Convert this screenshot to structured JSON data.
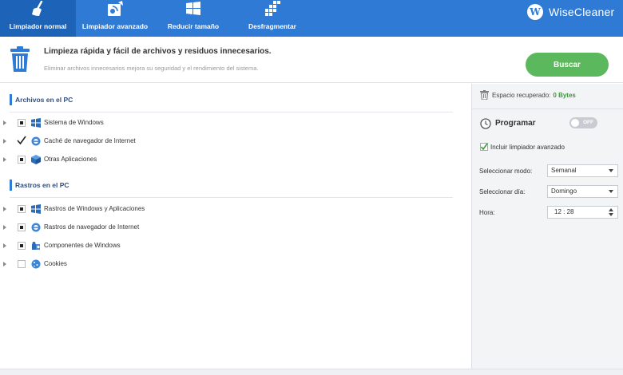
{
  "toolbar": {
    "tabs": [
      {
        "label": "Limpiador normal",
        "icon": "broom-icon",
        "active": true
      },
      {
        "label": "Limpiador avanzado",
        "icon": "advanced-clean-icon",
        "active": false
      },
      {
        "label": "Reducir tamaño",
        "icon": "windows-icon",
        "active": false
      },
      {
        "label": "Desfragmentar",
        "icon": "defrag-icon",
        "active": false
      }
    ],
    "brand_logo": "W",
    "brand_name": "WiseCleaner"
  },
  "header": {
    "title": "Limpieza rápida y fácil de archivos y residuos innecesarios.",
    "subtitle": "Eliminar archivos innecesarios mejora su seguridad y el rendimiento del sistema.",
    "scan_button": "Buscar"
  },
  "sections": [
    {
      "title": "Archivos en el PC",
      "items": [
        {
          "label": "Sistema de Windows",
          "state": "partial",
          "icon": "windows-flag-icon"
        },
        {
          "label": "Caché de navegador de Internet",
          "state": "checked",
          "icon": "internet-explorer-icon"
        },
        {
          "label": "Otras Aplicaciones",
          "state": "partial",
          "icon": "box-icon"
        }
      ]
    },
    {
      "title": "Rastros en el PC",
      "items": [
        {
          "label": "Rastros de Windows y Aplicaciones",
          "state": "partial",
          "icon": "windows-flag-icon"
        },
        {
          "label": "Rastros de navegador de Internet",
          "state": "partial",
          "icon": "internet-explorer-icon"
        },
        {
          "label": "Componentes de Windows",
          "state": "partial",
          "icon": "puzzle-icon"
        },
        {
          "label": "Cookies",
          "state": "unchecked",
          "icon": "cookie-icon"
        }
      ]
    }
  ],
  "side": {
    "recovered_label": "Espacio recuperado:",
    "recovered_value": "0 Bytes",
    "schedule_title": "Programar",
    "toggle_label": "OFF",
    "include_advanced": "Incluir limpiador avanzado",
    "mode_label": "Seleccionar modo:",
    "mode_value": "Semanal",
    "day_label": "Seleccionar día:",
    "day_value": "Domingo",
    "time_label": "Hora:",
    "time_value": "12 : 28"
  },
  "colors": {
    "toolbar": "#2e7ad4",
    "toolbar_active": "#1d63b8",
    "scan_button": "#5cb85c",
    "accent": "#2e7ad4",
    "recovered_value": "#3a9a3a"
  }
}
